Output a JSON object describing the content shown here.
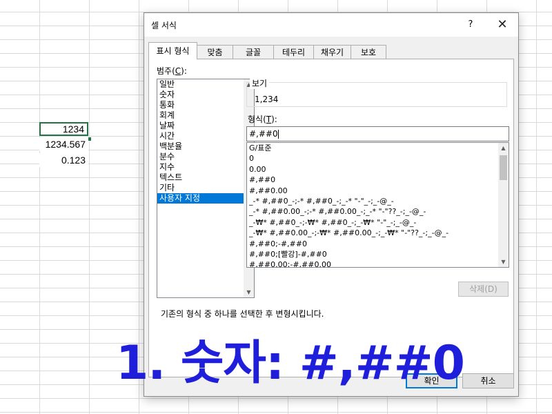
{
  "cells": [
    "1234",
    "1234.567",
    "0.123"
  ],
  "dialog": {
    "title": "셀 서식",
    "help": "?",
    "close": "✕",
    "tabs": [
      "표시 형식",
      "맞춤",
      "글꼴",
      "테두리",
      "채우기",
      "보호"
    ],
    "active_tab": 0,
    "category_label": "범주",
    "category_key": "C",
    "categories": [
      "일반",
      "숫자",
      "통화",
      "회계",
      "날짜",
      "시간",
      "백분율",
      "분수",
      "지수",
      "텍스트",
      "기타",
      "사용자 지정"
    ],
    "selected_category": 11,
    "preview_label": "보기",
    "preview_value": "1,234",
    "format_label": "형식",
    "format_key": "T",
    "format_value": "#,##0",
    "format_codes": [
      "G/표준",
      "0",
      "0.00",
      "#,##0",
      "#,##0.00",
      "_-* #,##0_-;-* #,##0_-;_-* \"-\"_-;_-@_-",
      "_-* #,##0.00_-;-* #,##0.00_-;_-* \"-\"??_-;_-@_-",
      "_-₩* #,##0_-;-₩* #,##0_-;_-₩* \"-\"_-;_-@_-",
      "_-₩* #,##0.00_-;-₩* #,##0.00_-;_-₩* \"-\"??_-;_-@_-",
      "#,##0;-#,##0",
      "#,##0;[빨강]-#,##0",
      "#,##0.00;-#,##0.00"
    ],
    "delete_label": "삭제",
    "delete_key": "D",
    "description": "기존의 형식 중 하나를 선택한 후 변형시킵니다.",
    "ok_label": "확인",
    "cancel_label": "취소"
  },
  "overlay_text": "1. 숫자: #,##0",
  "colors": {
    "accent": "#0078d7",
    "overlay": "#1f1fdb",
    "cell_border": "#217346"
  }
}
